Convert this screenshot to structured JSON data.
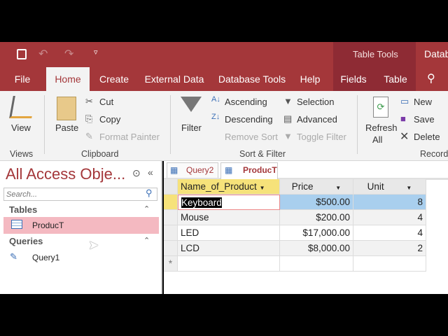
{
  "title_bar": {
    "context_label": "Table Tools",
    "db_label": "Datab"
  },
  "tabs": [
    "File",
    "Home",
    "Create",
    "External Data",
    "Database Tools",
    "Help",
    "Fields",
    "Table"
  ],
  "ribbon": {
    "view": "View",
    "paste": "Paste",
    "cut": "Cut",
    "copy": "Copy",
    "format_painter": "Format Painter",
    "filter": "Filter",
    "ascending": "Ascending",
    "descending": "Descending",
    "remove_sort": "Remove Sort",
    "selection": "Selection",
    "advanced": "Advanced",
    "toggle_filter": "Toggle Filter",
    "refresh": "Refresh",
    "all": "All",
    "new": "New",
    "save": "Save",
    "delete": "Delete",
    "groups": {
      "views": "Views",
      "clipboard": "Clipboard",
      "sort_filter": "Sort & Filter",
      "records": "Record"
    }
  },
  "nav": {
    "title": "All Access Obje...",
    "search_placeholder": "Search...",
    "tables_header": "Tables",
    "tables": [
      "ProducT"
    ],
    "queries_header": "Queries",
    "queries": [
      "Query1"
    ]
  },
  "doc_tabs": [
    "Query2",
    "ProducT"
  ],
  "table": {
    "columns": [
      "Name_of_Product",
      "Price",
      "Unit"
    ],
    "rows": [
      [
        "Keyboard",
        "$500.00",
        "8"
      ],
      [
        "Mouse",
        "$200.00",
        "4"
      ],
      [
        "LED",
        "$17,000.00",
        "4"
      ],
      [
        "LCD",
        "$8,000.00",
        "2"
      ]
    ],
    "new_row_marker": "*"
  },
  "colors": {
    "accent": "#a4373a",
    "selected_row": "#a9cfee",
    "nav_selected": "#f4b9c1"
  }
}
